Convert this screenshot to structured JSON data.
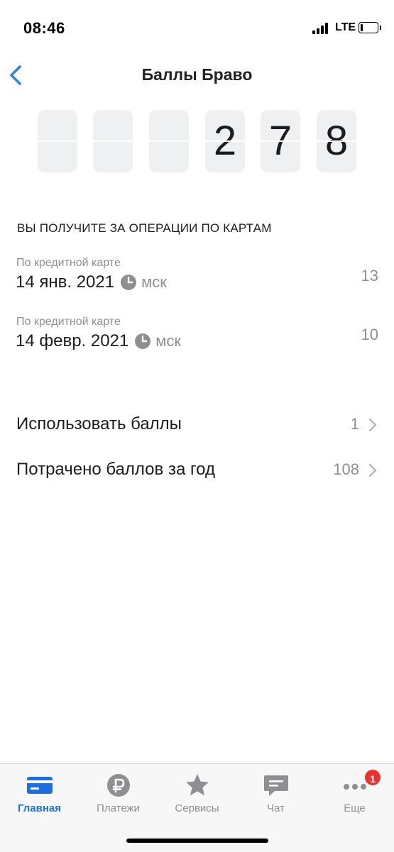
{
  "status_bar": {
    "time": "08:46",
    "network": "LTE",
    "battery_level": 0.12
  },
  "nav": {
    "title": "Баллы Браво",
    "back_icon": "chevron-left-icon"
  },
  "counter": {
    "value": 278,
    "digits": [
      "",
      "",
      "",
      "2",
      "7",
      "8"
    ]
  },
  "operations": {
    "header": "ВЫ ПОЛУЧИТЕ ЗА ОПЕРАЦИИ ПО КАРТАМ",
    "items": [
      {
        "kind": "По кредитной карте",
        "date": "14 янв. 2021",
        "timezone": "мск",
        "amount": "13"
      },
      {
        "kind": "По кредитной карте",
        "date": "14 февр. 2021",
        "timezone": "мск",
        "amount": "10"
      }
    ]
  },
  "actions": [
    {
      "label": "Использовать баллы",
      "value": "1"
    },
    {
      "label": "Потрачено баллов за год",
      "value": "108"
    }
  ],
  "tab_bar": {
    "active_tab": "Главная",
    "tabs": [
      {
        "label": "Главная",
        "icon": "card-icon"
      },
      {
        "label": "Платежи",
        "icon": "ruble-icon"
      },
      {
        "label": "Сервисы",
        "icon": "star-icon"
      },
      {
        "label": "Чат",
        "icon": "chat-icon"
      },
      {
        "label": "Еще",
        "icon": "more-icon",
        "badge": "1"
      }
    ]
  },
  "colors": {
    "accent": "#1f6ee0",
    "secondary_text": "#8e8e93",
    "badge": "#e8332f",
    "digit_card": "#eef0f2"
  }
}
